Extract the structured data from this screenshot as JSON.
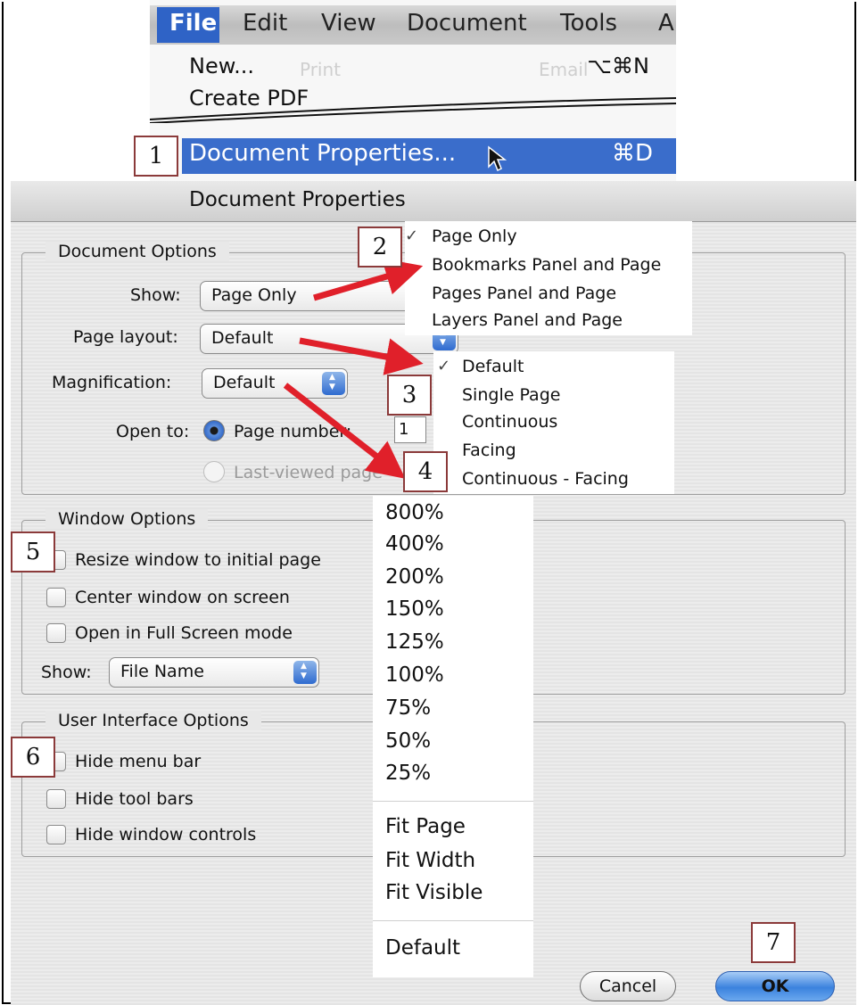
{
  "menu_bar": {
    "items": [
      "File",
      "Edit",
      "View",
      "Document",
      "Tools",
      "A"
    ],
    "toolbar_ghost": [
      "Print",
      "Email"
    ]
  },
  "file_menu": {
    "new_label": "New...",
    "new_shortcut": "⌥⌘N",
    "create_pdf_label": "Create PDF",
    "selected_label": "Document Properties...",
    "selected_shortcut": "⌘D"
  },
  "callouts": [
    "1",
    "2",
    "3",
    "4",
    "5",
    "6",
    "7"
  ],
  "dialog": {
    "title": "Document Properties",
    "document_options": {
      "title": "Document Options",
      "show_label": "Show:",
      "show_value": "Page Only",
      "page_layout_label": "Page layout:",
      "page_layout_value": "Default",
      "magnification_label": "Magnification:",
      "magnification_value": "Default",
      "open_to_label": "Open to:",
      "page_number_label": "Page number:",
      "page_number_value": "1",
      "last_viewed_label": "Last-viewed page"
    },
    "window_options": {
      "title": "Window Options",
      "resize_label": "Resize window to initial page",
      "center_label": "Center window on screen",
      "fullscreen_label": "Open in Full Screen mode",
      "show_label": "Show:",
      "show_value": "File Name"
    },
    "ui_options": {
      "title": "User Interface Options",
      "hide_menu_bar": "Hide menu bar",
      "hide_tool_bars": "Hide tool bars",
      "hide_window_controls": "Hide window controls"
    },
    "buttons": {
      "cancel": "Cancel",
      "ok": "OK"
    }
  },
  "show_menu": {
    "check": "✓",
    "options": [
      "Page Only",
      "Bookmarks Panel and Page",
      "Pages Panel and Page",
      "Layers Panel and Page"
    ]
  },
  "page_layout_menu": {
    "check": "✓",
    "options": [
      "Default",
      "Single Page",
      "Continuous",
      "Facing",
      "Continuous - Facing"
    ]
  },
  "magnification_menu": {
    "percents": [
      "800%",
      "400%",
      "200%",
      "150%",
      "125%",
      "100%",
      "75%",
      "50%",
      "25%"
    ],
    "fits": [
      "Fit Page",
      "Fit Width",
      "Fit Visible"
    ],
    "default": "Default"
  },
  "colors": {
    "selection_blue": "#3a6dcb",
    "callout_border": "#8b3a3a",
    "arrow_red": "#e0202a"
  }
}
